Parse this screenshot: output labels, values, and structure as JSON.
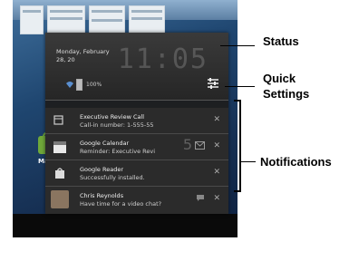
{
  "status": {
    "date_line1": "Monday, February",
    "date_line2": "28, 20",
    "clock": "11:05",
    "battery": "100%"
  },
  "notifications": [
    {
      "icon": "calendar-icon",
      "title": "Executive Review Call",
      "detail": "Call-in number: 1-555-55"
    },
    {
      "icon": "calendar-app-icon",
      "title": "Google Calendar",
      "detail": "Reminder: Executive Revi"
    },
    {
      "icon": "shopping-bag-icon",
      "title": "Google Reader",
      "detail": "Successfully installed."
    },
    {
      "icon": "avatar",
      "title": "Chris Reynolds",
      "detail": "Have time for a video chat?"
    }
  ],
  "notif_badge": "5",
  "home_app_label": "Marke",
  "callouts": {
    "status": "Status",
    "quick_settings_line1": "Quick",
    "quick_settings_line2": "Settings",
    "notifications": "Notifications"
  }
}
